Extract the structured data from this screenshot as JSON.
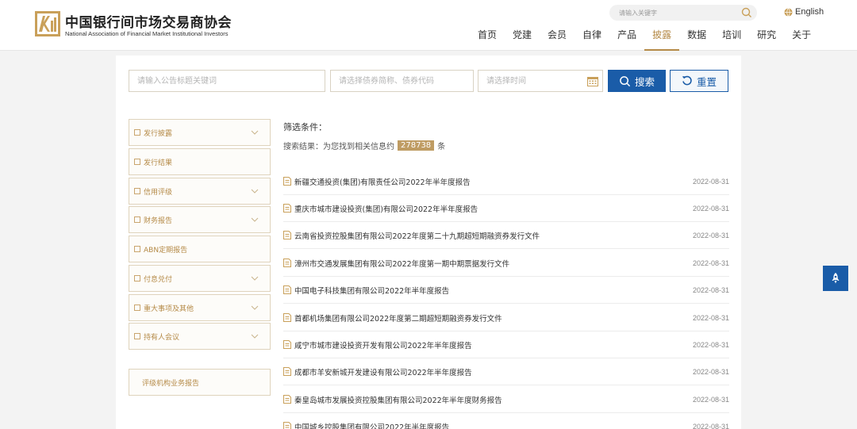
{
  "header": {
    "org_name_cn": "中国银行间市场交易商协会",
    "org_name_en": "National Association of Financial Market Institutional Investors",
    "top_search_placeholder": "请输入关键字",
    "language_label": "English"
  },
  "nav": [
    {
      "label": "首页"
    },
    {
      "label": "党建"
    },
    {
      "label": "会员"
    },
    {
      "label": "自律"
    },
    {
      "label": "产品"
    },
    {
      "label": "披露",
      "active": true
    },
    {
      "label": "数据"
    },
    {
      "label": "培训"
    },
    {
      "label": "研究"
    },
    {
      "label": "关于"
    }
  ],
  "search": {
    "title_placeholder": "请输入公告标题关键词",
    "bond_placeholder": "请选择债券简称、债券代码",
    "time_placeholder": "请选择时间",
    "search_label": "搜索",
    "reset_label": "重置"
  },
  "categories": [
    {
      "label": "发行披露",
      "has_chevron": true
    },
    {
      "label": "发行结果",
      "has_chevron": false
    },
    {
      "label": "信用评级",
      "has_chevron": true
    },
    {
      "label": "财务报告",
      "has_chevron": true
    },
    {
      "label": "ABN定期报告",
      "has_chevron": false
    },
    {
      "label": "付息兑付",
      "has_chevron": true
    },
    {
      "label": "重大事项及其他",
      "has_chevron": true
    },
    {
      "label": "持有人会议",
      "has_chevron": true
    }
  ],
  "sidebar_extra": "评级机构业务报告",
  "filter": {
    "label": "筛选条件：",
    "result_prefix": "搜索结果：为您找到相关信息约",
    "result_count": "278738",
    "result_suffix": "条"
  },
  "results": [
    {
      "title": "新疆交通投资(集团)有限责任公司2022年半年度报告",
      "date": "2022-08-31"
    },
    {
      "title": "重庆市城市建设投资(集团)有限公司2022年半年度报告",
      "date": "2022-08-31"
    },
    {
      "title": "云南省投资控股集团有限公司2022年度第二十九期超短期融资券发行文件",
      "date": "2022-08-31"
    },
    {
      "title": "漳州市交通发展集团有限公司2022年度第一期中期票据发行文件",
      "date": "2022-08-31"
    },
    {
      "title": "中国电子科技集团有限公司2022年半年度报告",
      "date": "2022-08-31"
    },
    {
      "title": "首都机场集团有限公司2022年度第二期超短期融资券发行文件",
      "date": "2022-08-31"
    },
    {
      "title": "咸宁市城市建设投资开发有限公司2022年半年度报告",
      "date": "2022-08-31"
    },
    {
      "title": "成都市羊安新城开发建设有限公司2022年半年度报告",
      "date": "2022-08-31"
    },
    {
      "title": "秦皇岛城市发展投资控股集团有限公司2022年半年度财务报告",
      "date": "2022-08-31"
    },
    {
      "title": "中国城乡控股集团有限公司2022年半年度报告",
      "date": "2022-08-31"
    }
  ],
  "colors": {
    "accent_gold": "#b58a47",
    "primary_blue": "#1a5ca8"
  },
  "icons": {
    "logo": "nafmii-logo-icon",
    "search": "search-icon",
    "globe": "globe-icon",
    "calendar": "calendar-icon",
    "reset": "refresh-icon",
    "document": "document-icon",
    "chevron": "chevron-down-icon",
    "back_to_top": "rocket-icon"
  }
}
